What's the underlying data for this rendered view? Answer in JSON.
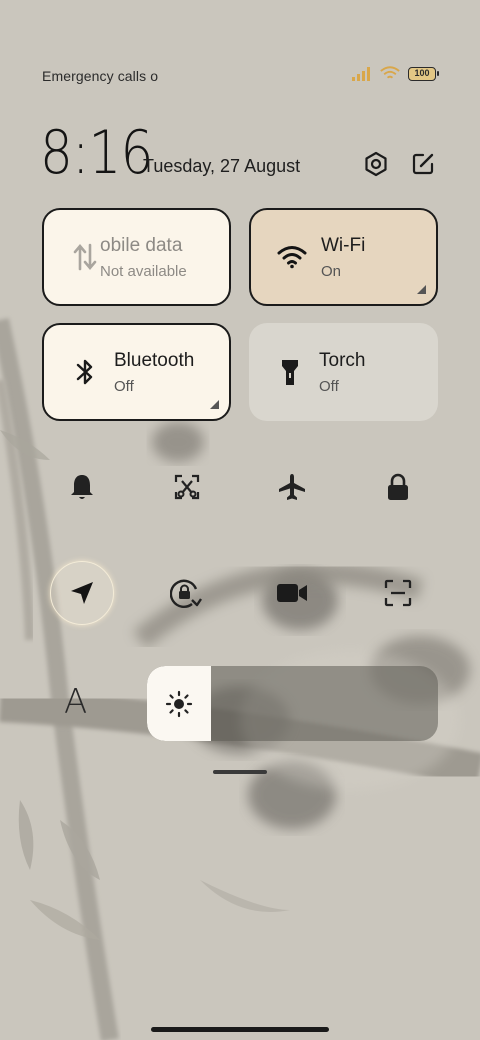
{
  "status_bar": {
    "left_text": "Emergency calls o",
    "signal_icon": "signal-icon",
    "wifi_icon": "wifi-icon",
    "battery_level": "100"
  },
  "header": {
    "time": "8:16",
    "date": "Tuesday, 27 August",
    "settings_icon": "settings-icon",
    "edit_icon": "edit-icon"
  },
  "tiles": [
    {
      "label": "obile data",
      "status": "Not available",
      "icon": "mobile-data-icon"
    },
    {
      "label": "Wi-Fi",
      "status": "On",
      "icon": "wifi-icon"
    },
    {
      "label": "Bluetooth",
      "status": "Off",
      "icon": "bluetooth-icon"
    },
    {
      "label": "Torch",
      "status": "Off",
      "icon": "torch-icon"
    }
  ],
  "quick_toggles": [
    {
      "icon": "bell-icon"
    },
    {
      "icon": "screenshot-icon"
    },
    {
      "icon": "airplane-icon"
    },
    {
      "icon": "lock-icon"
    },
    {
      "icon": "location-icon",
      "active": true
    },
    {
      "icon": "rotation-lock-icon"
    },
    {
      "icon": "video-icon"
    },
    {
      "icon": "scanner-icon"
    }
  ],
  "brightness": {
    "font_button": "A",
    "level": 0.22,
    "icon": "sun-icon"
  },
  "colors": {
    "background": "#cac6bd",
    "tile_active_light": "#fbf5ea",
    "tile_active_warm": "#e6d6bf",
    "battery": "#e3c785"
  }
}
